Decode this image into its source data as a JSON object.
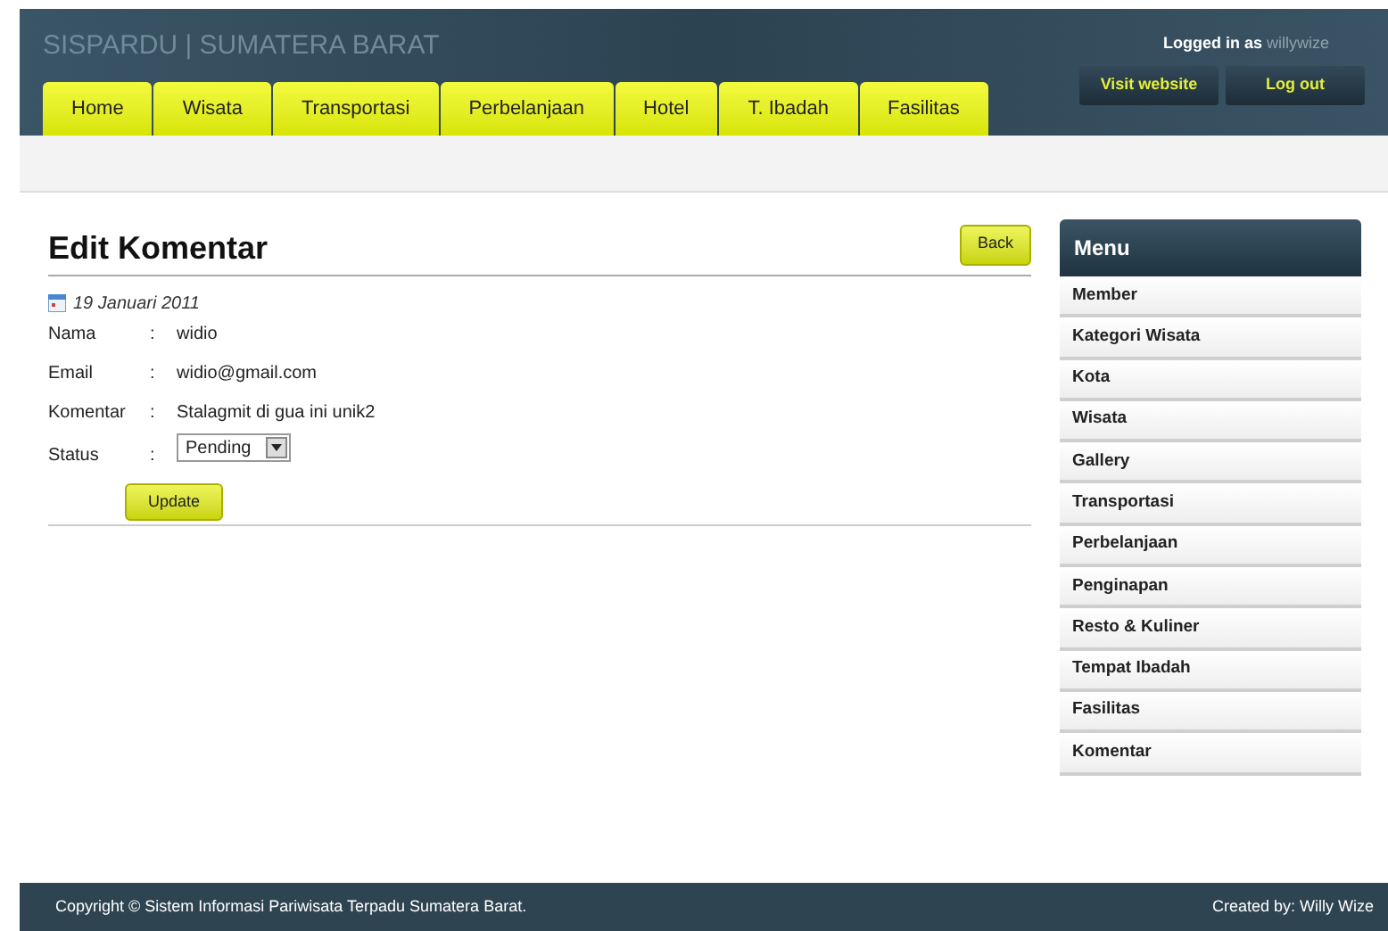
{
  "header": {
    "title": "SISPARDU | SUMATERA BARAT",
    "logged_in_label": "Logged in as",
    "username": "willywize",
    "buttons": [
      "Visit website",
      "Log out"
    ]
  },
  "tabs": [
    {
      "label": "Home"
    },
    {
      "label": "Wisata"
    },
    {
      "label": "Transportasi"
    },
    {
      "label": "Perbelanjaan"
    },
    {
      "label": "Hotel"
    },
    {
      "label": "T. Ibadah"
    },
    {
      "label": "Fasilitas"
    }
  ],
  "page": {
    "title": "Edit Komentar",
    "back_button": "Back",
    "date": "19 Januari 2011",
    "fields": [
      {
        "kind": "text",
        "label": "Nama",
        "separator": ":",
        "value": "widio"
      },
      {
        "kind": "text",
        "label": "Email",
        "separator": ":",
        "value": "widio@gmail.com"
      },
      {
        "kind": "text",
        "label": "Komentar",
        "separator": ":",
        "value": "Stalagmit di gua ini unik2"
      },
      {
        "kind": "select",
        "label": "Status",
        "separator": ":",
        "value": "Pending"
      }
    ],
    "submit_button": "Update"
  },
  "sidebar": {
    "title": "Menu",
    "items": [
      "Member",
      "Kategori Wisata",
      "Kota",
      "Wisata",
      "Gallery",
      "Transportasi",
      "Perbelanjaan",
      "Penginapan",
      "Resto & Kuliner",
      "Tempat Ibadah",
      "Fasilitas",
      "Komentar"
    ]
  },
  "footer": {
    "copyright": "Copyright © Sistem Informasi Pariwisata Terpadu Sumatera Barat.",
    "credit": "Created by: Willy Wize"
  }
}
